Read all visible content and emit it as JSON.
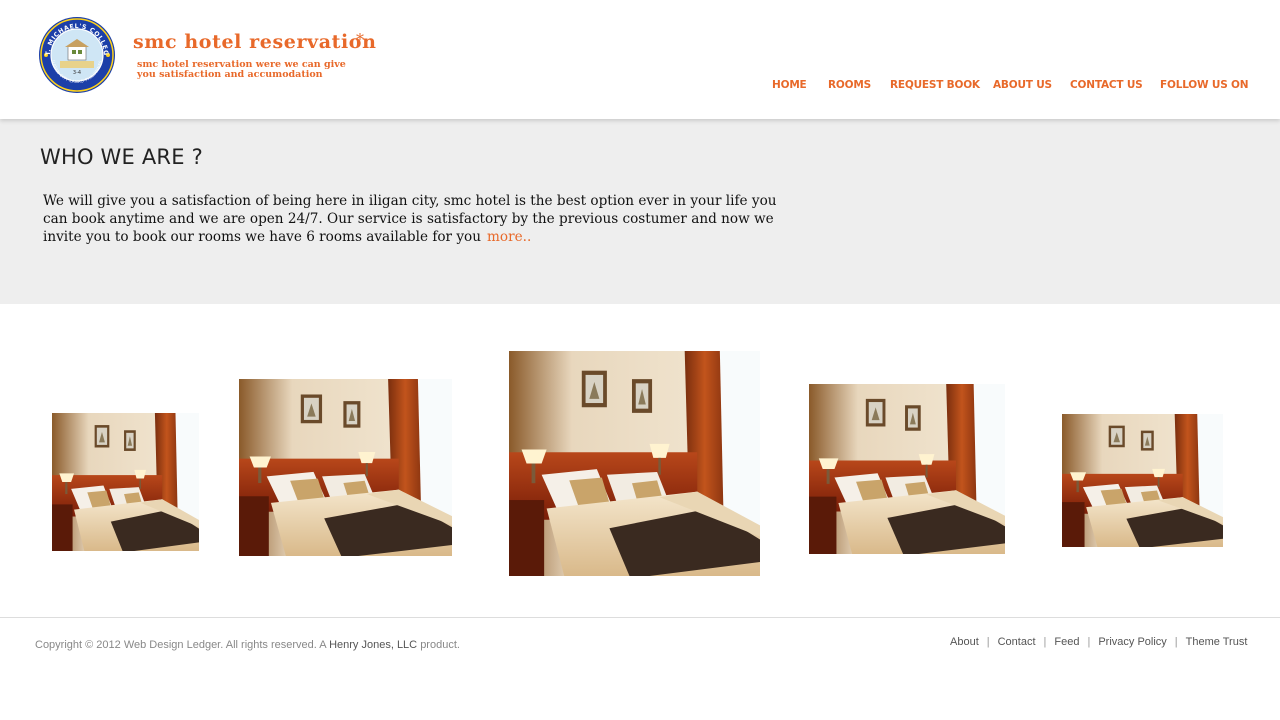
{
  "header": {
    "brand_title": "smc hotel reservation",
    "brand_star": "*",
    "tagline_line1": "smc hotel reservation were we can give",
    "tagline_line2": "you  satisfaction and accumodation",
    "seal_text": "ST. MICHAEL'S COLLEGE",
    "seal_sub": "ILIGAN CITY LANAO PHILIPPINES",
    "nav": [
      "HOME",
      "ROOMS",
      "REQUEST BOOK",
      "ABOUT US",
      "CONTACT US",
      "FOLLOW US  ON"
    ]
  },
  "intro": {
    "heading": "WHO WE ARE ?",
    "text": "We will give you a satisfaction of being here in iligan city, smc hotel is the best option ever in your life you can book anytime and we are open 24/7. Our service is satisfactory by the previous costumer and now we invite you to book our rooms we have 6 rooms available for you",
    "more": "more.."
  },
  "gallery": {
    "photos": [
      {
        "icon": "hotel-room-photo"
      },
      {
        "icon": "hotel-room-photo"
      },
      {
        "icon": "hotel-room-photo"
      },
      {
        "icon": "hotel-room-photo"
      },
      {
        "icon": "hotel-room-photo"
      }
    ]
  },
  "footer": {
    "copyright_prefix": "Copyright © 2012 Web Design Ledger. All rights reserved. A",
    "company": "Henry Jones, LLC",
    "copyright_suffix": "product.",
    "links": [
      "About",
      "Contact",
      "Feed",
      "Privacy Policy",
      "Theme Trust"
    ],
    "separator": "|"
  },
  "colors": {
    "accent": "#e8692a",
    "band": "#eeeeee",
    "text": "#111111"
  }
}
